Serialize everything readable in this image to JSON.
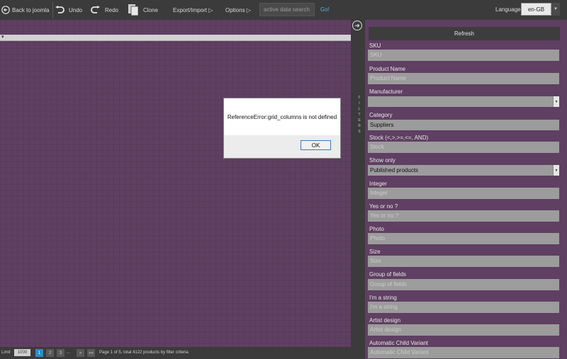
{
  "toolbar": {
    "back_label": "Back to joomla",
    "undo_label": "Undo",
    "redo_label": "Redo",
    "clone_label": "Clone",
    "export_label": "Export/Import ▷",
    "options_label": "Options ▷",
    "search_placeholder": "active data search",
    "go_label": "Go!",
    "language_label": "Language",
    "language_value": "en-GB"
  },
  "grid": {
    "header_mark": "▾"
  },
  "footer": {
    "limit_label": "Limit",
    "limit_value": "1000",
    "pages": [
      "1",
      "2",
      "3"
    ],
    "dots": "...",
    "next": "»",
    "last": "»»",
    "info": "Page 1 of 5, total 4122 products by filter criteria"
  },
  "filters": {
    "title": "FILTERS",
    "refresh_label": "Refresh",
    "fields": [
      {
        "label": "SKU",
        "placeholder": "SKU"
      },
      {
        "label": "Product Name",
        "placeholder": "Product Name"
      },
      {
        "label": "Manufacturer",
        "value": ""
      },
      {
        "label": "Category",
        "value": "Suppliers"
      },
      {
        "label": "Stock (<,>,>=,<=, AND)",
        "placeholder": "Stock"
      },
      {
        "label": "Show only",
        "value": "Published products"
      },
      {
        "label": "Integer",
        "placeholder": "Integer"
      },
      {
        "label": "Yes or no ?",
        "placeholder": "Yes or no ?"
      },
      {
        "label": "Photo",
        "placeholder": "Photo"
      },
      {
        "label": "Size",
        "placeholder": "Size"
      },
      {
        "label": "Group of fields",
        "placeholder": "Group of fields"
      },
      {
        "label": "I'm a string",
        "placeholder": "I'm a string"
      },
      {
        "label": "Artist design",
        "placeholder": "Artist design"
      },
      {
        "label": "Automatic Child Variant",
        "placeholder": "Automatic Child Variant"
      }
    ]
  },
  "dialog": {
    "message": "ReferenceError:grid_columns is not defined",
    "ok_label": "OK"
  }
}
